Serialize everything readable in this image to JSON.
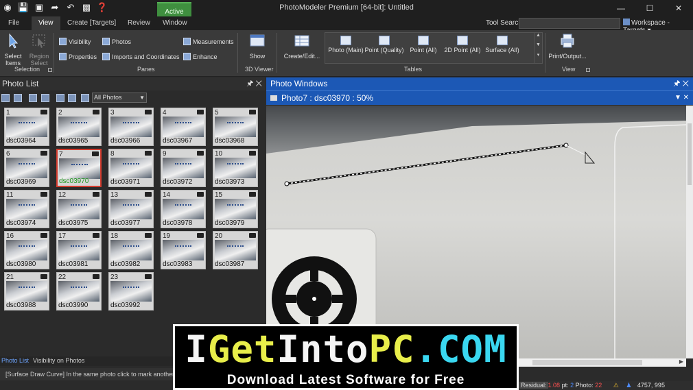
{
  "app": {
    "title": "PhotoModeler Premium [64-bit]: Untitled",
    "active_badge": "Active"
  },
  "window_controls": {
    "minimize": "—",
    "maximize": "☐",
    "close": "✕"
  },
  "ribbon_tabs": [
    "File",
    "View",
    "Create  [Targets]",
    "Review",
    "Window"
  ],
  "selected_tab": "View",
  "tool_search_label": "Tool Search",
  "workspace_label": "Workspace - Targets ▾",
  "ribbon": {
    "select_items": "Select Items",
    "region_select": "Region Select",
    "selection_group": "Selection",
    "visibility": "Visibility",
    "properties": "Properties",
    "photos": "Photos",
    "imports_coords": "Imports and Coordinates",
    "measurements": "Measurements",
    "enhance": "Enhance",
    "panes_group": "Panes",
    "show": "Show",
    "viewer_group": "3D Viewer",
    "create_edit": "Create/Edit...",
    "tables_items": [
      "Photo (Main)",
      "Point (Quality)",
      "Point (All)",
      "2D Point (All)",
      "Surface (All)"
    ],
    "tables_group": "Tables",
    "print_output": "Print/Output...",
    "view_group": "View"
  },
  "photo_list": {
    "title": "Photo List",
    "filter_value": "All Photos",
    "photos": [
      {
        "n": "1",
        "name": "dsc03964"
      },
      {
        "n": "2",
        "name": "dsc03965"
      },
      {
        "n": "3",
        "name": "dsc03966"
      },
      {
        "n": "4",
        "name": "dsc03967"
      },
      {
        "n": "5",
        "name": "dsc03968"
      },
      {
        "n": "6",
        "name": "dsc03969"
      },
      {
        "n": "7",
        "name": "dsc03970"
      },
      {
        "n": "8",
        "name": "dsc03971"
      },
      {
        "n": "9",
        "name": "dsc03972"
      },
      {
        "n": "10",
        "name": "dsc03973"
      },
      {
        "n": "11",
        "name": "dsc03974"
      },
      {
        "n": "12",
        "name": "dsc03975"
      },
      {
        "n": "13",
        "name": "dsc03977"
      },
      {
        "n": "14",
        "name": "dsc03978"
      },
      {
        "n": "15",
        "name": "dsc03979"
      },
      {
        "n": "16",
        "name": "dsc03980"
      },
      {
        "n": "17",
        "name": "dsc03981"
      },
      {
        "n": "18",
        "name": "dsc03982"
      },
      {
        "n": "19",
        "name": "dsc03983"
      },
      {
        "n": "20",
        "name": "dsc03987"
      },
      {
        "n": "21",
        "name": "dsc03988"
      },
      {
        "n": "22",
        "name": "dsc03990"
      },
      {
        "n": "23",
        "name": "dsc03992"
      }
    ],
    "selected": "7"
  },
  "bottom_tabs": [
    "Photo List",
    "Visibility on Photos"
  ],
  "status_message": "[Surface Draw Curve] In the same photo click to mark another po",
  "photo_windows": {
    "title": "Photo Windows",
    "current": "Photo7 : dsc03970 : 50%"
  },
  "statusbar": {
    "residual_label": "Residual:",
    "residual_value": "1.08",
    "pt_label": "pt:",
    "pt_value": "2",
    "photo_label": "Photo:",
    "photo_value": "22",
    "coords": "4757, 995"
  },
  "banner": {
    "title_parts": [
      "I",
      "Get",
      "Into",
      "PC",
      ".",
      "COM"
    ],
    "subtitle": "Download Latest Software for Free"
  },
  "colors": {
    "accent": "#1c58b5",
    "selected_border": "#d33c2e",
    "active_green": "#3f8f3f"
  }
}
